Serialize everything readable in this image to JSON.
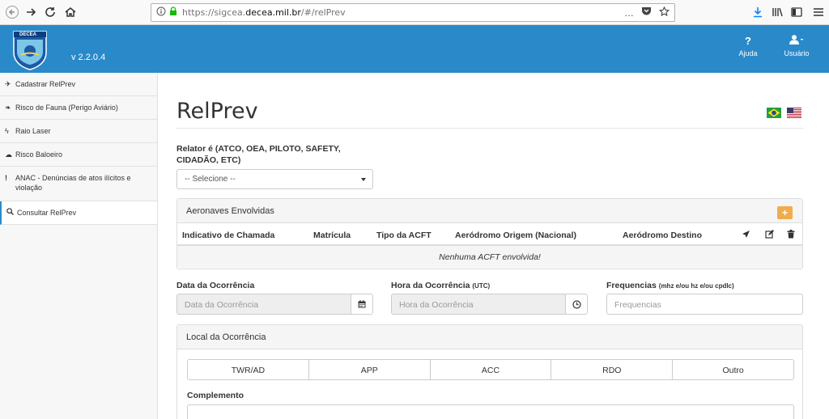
{
  "browser": {
    "url_prefix": "https://sigcea.",
    "url_domain": "decea.mil.br",
    "url_path": "/#/relPrev",
    "more_icon": "…"
  },
  "header": {
    "logo_text": "DECEA",
    "version": "v 2.2.0.4",
    "help_label": "Ajuda",
    "user_label": "Usuário"
  },
  "sidebar": {
    "items": [
      {
        "icon": "✈",
        "label": "Cadastrar RelPrev"
      },
      {
        "icon": "❧",
        "label": "Risco de Fauna (Perigo Aviário)"
      },
      {
        "icon": "ϟ",
        "label": "Raio Laser"
      },
      {
        "icon": "☁",
        "label": "Risco Baloeiro"
      },
      {
        "icon": "!",
        "label": "ANAC - Denúncias de atos ilícitos e violação"
      },
      {
        "icon": "⚲",
        "label": "Consultar RelPrev"
      }
    ]
  },
  "main": {
    "title": "RelPrev",
    "relator_label": "Relator é (ATCO, OEA, PILOTO, SAFETY, CIDADÃO, ETC)",
    "relator_select": "-- Selecione --",
    "aeronaves": {
      "title": "Aeronaves Envolvidas",
      "add_label": "+",
      "columns": [
        "Indicativo de Chamada",
        "Matrícula",
        "Tipo da ACFT",
        "Aeródromo Origem (Nacional)",
        "Aeródromo Destino"
      ],
      "empty_text": "Nenhuma ACFT envolvida!"
    },
    "data_ocorrencia": {
      "label": "Data da Ocorrência",
      "placeholder": "Data da Ocorrência"
    },
    "hora_ocorrencia": {
      "label": "Hora da Ocorrência",
      "label_small": "(UTC)",
      "placeholder": "Hora da Ocorrência"
    },
    "frequencias": {
      "label": "Frequencias",
      "label_small": "(mhz e/ou hz e/ou cpdlc)",
      "placeholder": "Frequencias"
    },
    "local": {
      "title": "Local da Ocorrência",
      "options": [
        "TWR/AD",
        "APP",
        "ACC",
        "RDO",
        "Outro"
      ],
      "complemento_label": "Complemento"
    }
  },
  "colors": {
    "brand": "#2a8ac9",
    "warning": "#f0ad4e"
  }
}
